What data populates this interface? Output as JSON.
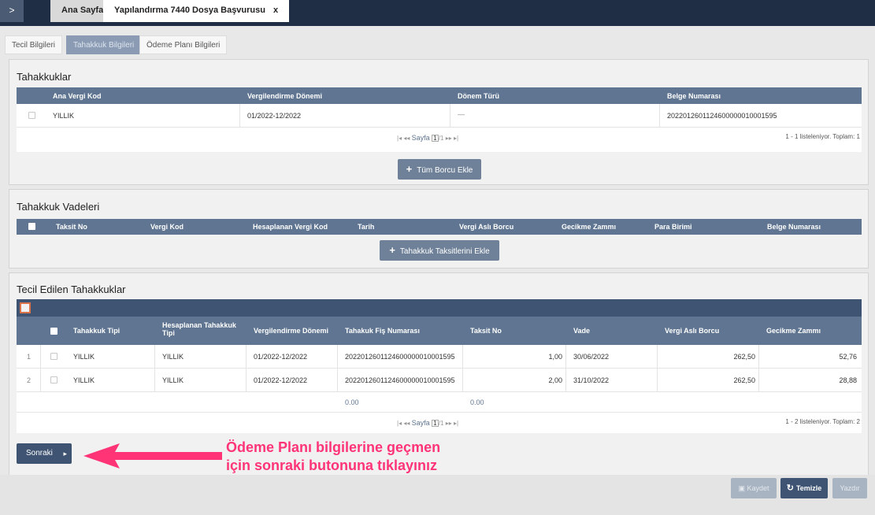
{
  "top_tabs": {
    "toggle": ">",
    "home": "Ana Sayfa",
    "active": "Yapılandırma 7440 Dosya Başvurusu",
    "close": "x"
  },
  "sub_tabs": [
    "Tecil Bilgileri",
    "Tahakkuk Bilgileri",
    "Ödeme Planı Bilgileri"
  ],
  "tahakkuklar": {
    "title": "Tahakkuklar",
    "columns": [
      "Ana Vergi Kod",
      "Vergilendirme Dönemi",
      "Dönem Türü",
      "Belge Numarası"
    ],
    "rows": [
      {
        "ana_vergi_kod": "YILLIK",
        "donem": "01/2022-12/2022",
        "donem_turu": "—",
        "belge_no": "2022012601124600000010001595"
      }
    ],
    "pager": {
      "sayfa": "Sayfa",
      "page": "1",
      "total": "/1"
    },
    "count": "1 - 1 listeleniyor. Toplam: 1",
    "button": "Tüm Borcu Ekle"
  },
  "vadeler": {
    "title": "Tahakkuk Vadeleri",
    "columns": [
      "Taksit No",
      "Vergi Kod",
      "Hesaplanan Vergi Kod",
      "Tarih",
      "Vergi Aslı Borcu",
      "Gecikme Zammı",
      "Para Birimi",
      "Belge Numarası"
    ],
    "button": "Tahakkuk Taksitlerini Ekle"
  },
  "tecil": {
    "title": "Tecil Edilen Tahakkuklar",
    "columns": [
      "Tahakkuk Tipi",
      "Hesaplanan Tahakkuk Tipi",
      "Vergilendirme Dönemi",
      "Tahakuk Fiş Numarası",
      "Taksit No",
      "Vade",
      "Vergi Aslı Borcu",
      "Gecikme Zammı"
    ],
    "rows": [
      {
        "n": "1",
        "tip": "YILLIK",
        "hes_tip": "YILLIK",
        "donem": "01/2022-12/2022",
        "fis_no": "2022012601124600000010001595",
        "taksit": "1,00",
        "vade": "30/06/2022",
        "asli": "262,50",
        "gecikme": "52,76"
      },
      {
        "n": "2",
        "tip": "YILLIK",
        "hes_tip": "YILLIK",
        "donem": "01/2022-12/2022",
        "fis_no": "2022012601124600000010001595",
        "taksit": "2,00",
        "vade": "31/10/2022",
        "asli": "262,50",
        "gecikme": "28,88"
      }
    ],
    "totals": {
      "a": "0.00",
      "b": "0.00"
    },
    "pager": {
      "sayfa": "Sayfa",
      "page": "1",
      "total": "/1"
    },
    "count": "1 - 2 listeleniyor. Toplam: 2"
  },
  "next_button": {
    "label": "Sonraki",
    "arrow": "▸"
  },
  "annotation": {
    "line1": "Ödeme Planı bilgilerine geçmen",
    "line2": "için sonraki butonuna tıklayınız"
  },
  "footer": {
    "save": "Kaydet",
    "clear": "Temizle",
    "print": "Yazdır"
  },
  "colors": {
    "header": "#5f7591",
    "topbar": "#1f2d45",
    "annotation": "#ff3477"
  }
}
